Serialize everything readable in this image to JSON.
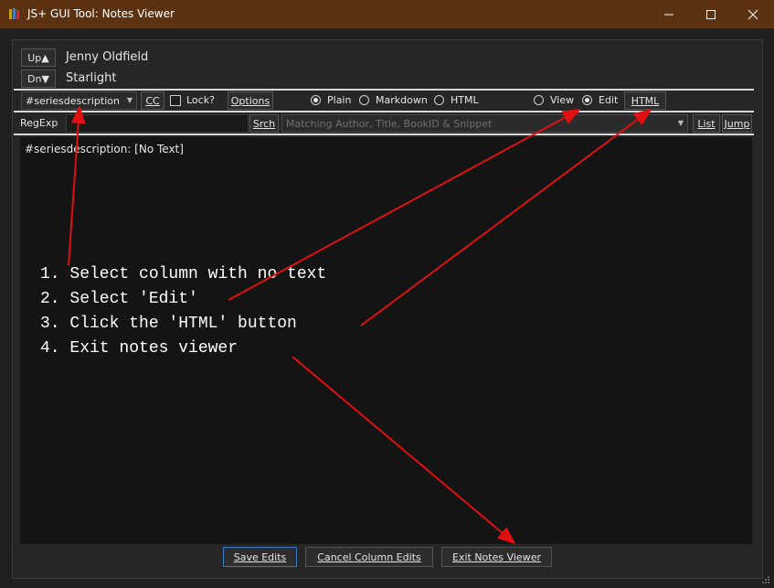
{
  "window": {
    "title": "JS+ GUI Tool:  Notes Viewer",
    "controls": [
      "minimize",
      "maximize",
      "close"
    ]
  },
  "nav": {
    "up_label": "Up▲",
    "down_label": "Dn▼",
    "author": "Jenny Oldfield",
    "book_title": "Starlight"
  },
  "toolbar": {
    "column_select": "#seriesdescription",
    "cc_label": "CC",
    "lock_label": "Lock?",
    "lock_checked": false,
    "options_label": "Options",
    "format_options": [
      {
        "label": "Plain",
        "selected": true
      },
      {
        "label": "Markdown",
        "selected": false
      },
      {
        "label": "HTML",
        "selected": false
      }
    ],
    "mode_options": [
      {
        "label": "View",
        "selected": false
      },
      {
        "label": "Edit",
        "selected": true
      }
    ],
    "html_button_label": "HTML"
  },
  "search": {
    "regexp_label": "RegExp",
    "regexp_value": "",
    "srch_label": "Srch",
    "scope_placeholder": "Matching Author, Title, BookID & Snippet",
    "list_label": "List",
    "jump_label": "Jump"
  },
  "editor": {
    "content": "#seriesdescription:  [No Text]"
  },
  "annotations": [
    "1. Select column with no text",
    "2. Select 'Edit'",
    "3. Click the 'HTML' button",
    "4. Exit notes viewer"
  ],
  "annotation_color": "#e01010",
  "footer": {
    "save_label": "Save Edits",
    "cancel_label": "Cancel Column Edits",
    "exit_label": "Exit Notes Viewer"
  }
}
